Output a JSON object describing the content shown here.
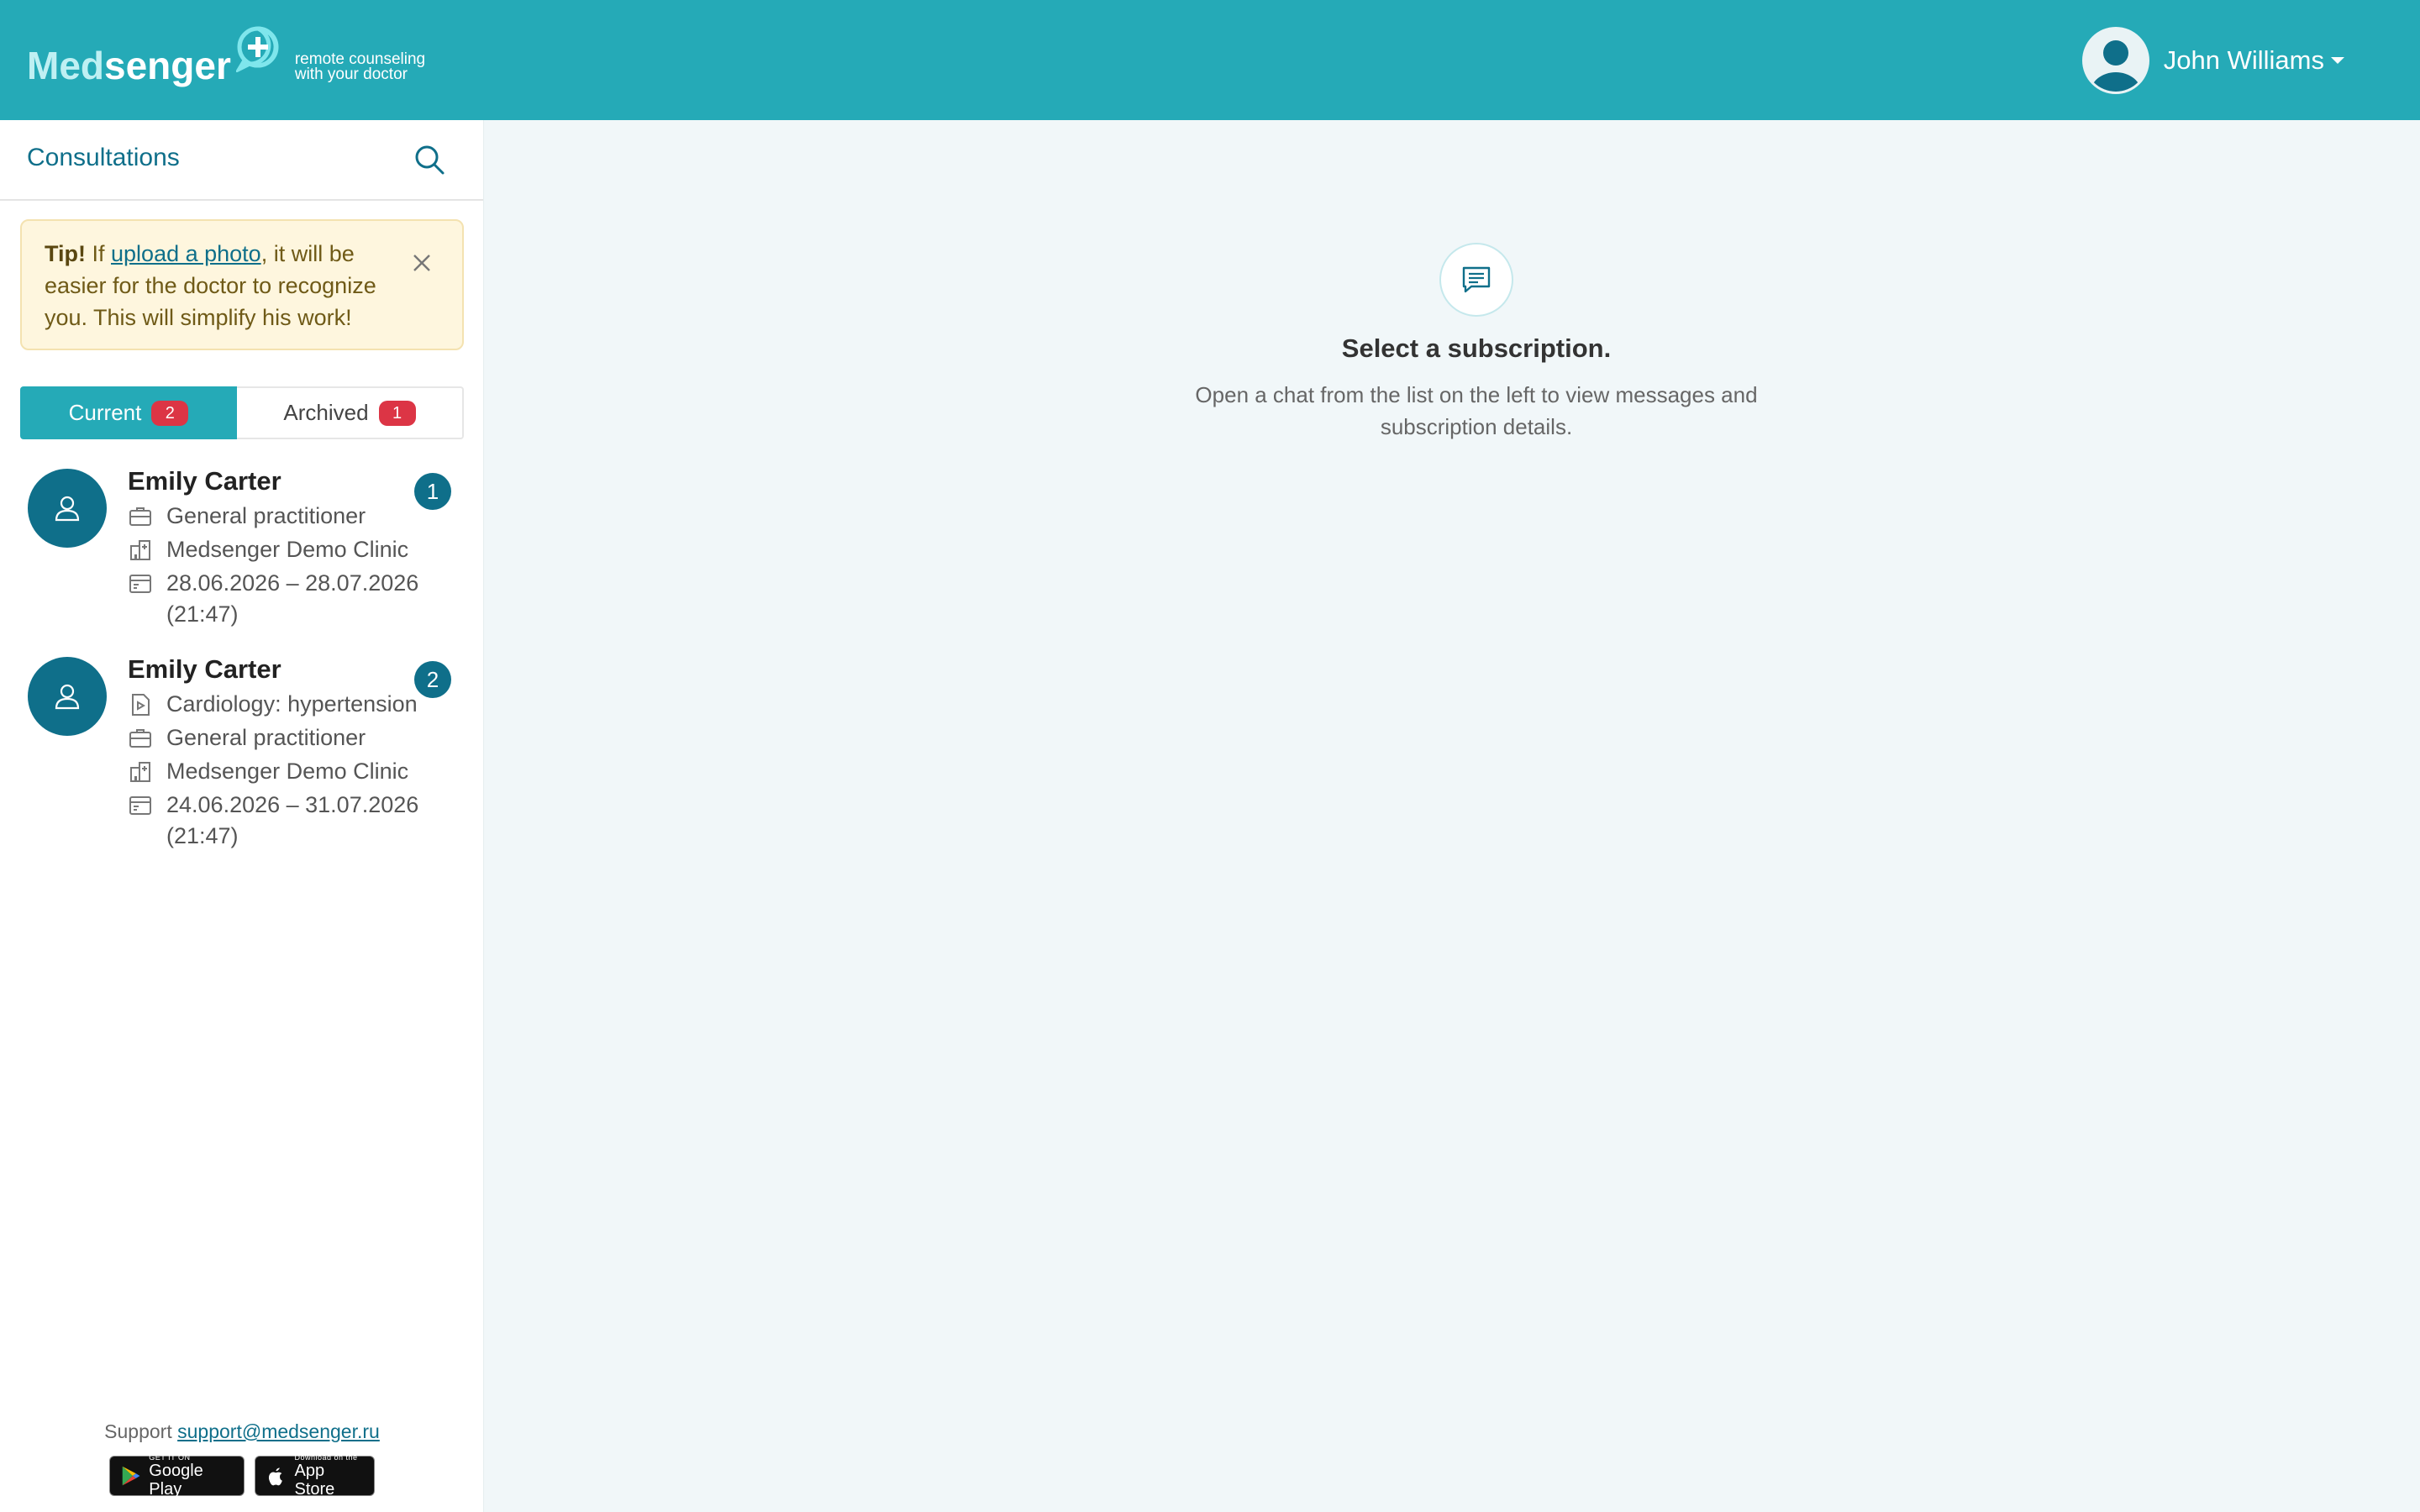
{
  "header": {
    "brand_prefix": "Med",
    "brand_suffix": "senger",
    "tagline_line1": "remote counseling",
    "tagline_line2": "with your doctor",
    "user_name": "John Williams"
  },
  "sidebar": {
    "title": "Consultations",
    "tip": {
      "bold": "Tip!",
      "before_link": " If ",
      "link": "upload a photo",
      "after_link": ", it will be easier for the doctor to recognize you. This will simplify his work!"
    },
    "tabs": [
      {
        "label": "Current",
        "badge": "2"
      },
      {
        "label": "Archived",
        "badge": "1"
      }
    ],
    "subscriptions": [
      {
        "name": "Emily Carter",
        "count": "1",
        "specialty": "General practitioner",
        "clinic": "Medsenger Demo Clinic",
        "dates": "28.06.2026 – 28.07.2026 (21:47)"
      },
      {
        "name": "Emily Carter",
        "count": "2",
        "program": "Cardiology: hypertension",
        "specialty": "General practitioner",
        "clinic": "Medsenger Demo Clinic",
        "dates": "24.06.2026 – 31.07.2026 (21:47)"
      }
    ],
    "footer": {
      "support_label": "Support",
      "support_email": "support@medsenger.ru",
      "google_small": "GET IT ON",
      "google_big": "Google Play",
      "apple_small": "Download on the",
      "apple_big": "App Store"
    }
  },
  "main": {
    "empty_title": "Select a subscription.",
    "empty_text_line1": "Open a chat from the list on the left to view messages and",
    "empty_text_line2": "subscription details."
  },
  "colors": {
    "header": "#25aab7",
    "accent": "#0f6f8a",
    "badge": "#dc3545",
    "tip_bg": "#fef6de"
  }
}
